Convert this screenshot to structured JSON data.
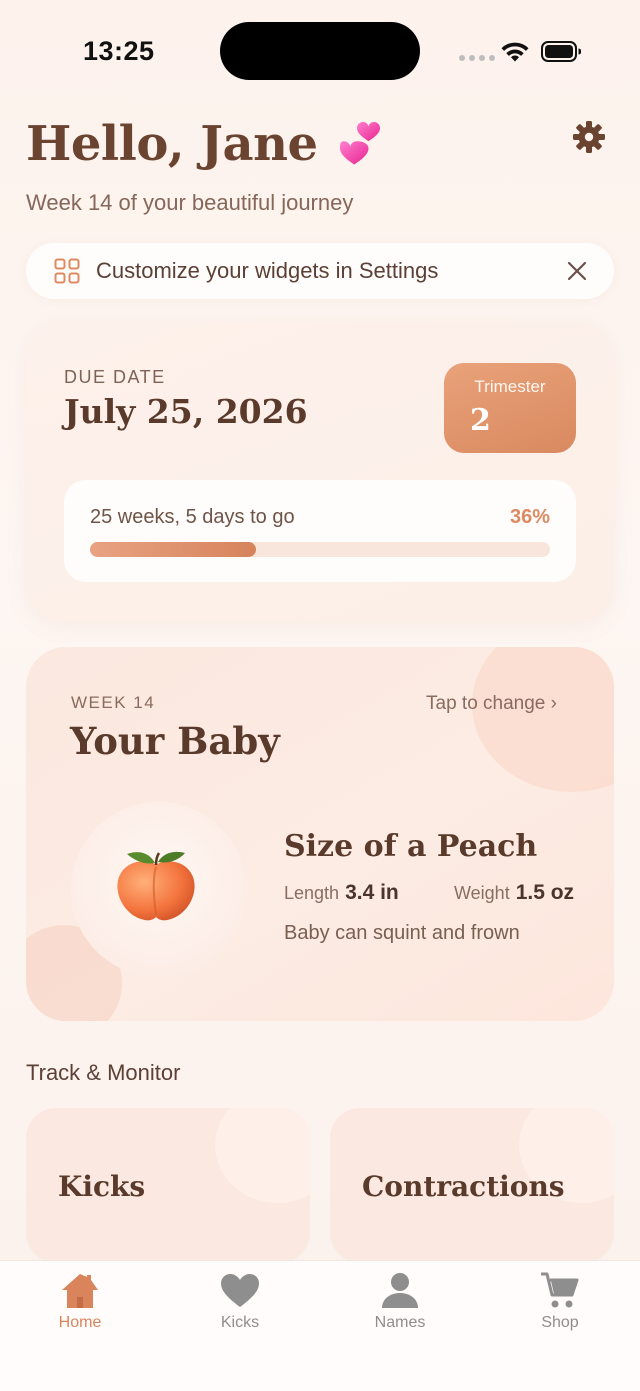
{
  "status_bar": {
    "time": "13:25"
  },
  "header": {
    "greeting": "Hello, Jane",
    "subtitle": "Week 14 of your beautiful journey"
  },
  "banner": {
    "text": "Customize your widgets in Settings"
  },
  "due_card": {
    "label": "DUE DATE",
    "date": "July 25, 2026",
    "trimester_label": "Trimester",
    "trimester_value": "2",
    "countdown": "25 weeks, 5 days to go",
    "progress_text": "36%",
    "progress_value": 0.36
  },
  "baby_card": {
    "week_label": "WEEK 14",
    "tap_label": "Tap to change ›",
    "title": "Your Baby",
    "size_title": "Size of a Peach",
    "length_label": "Length",
    "length_value": "3.4 in",
    "weight_label": "Weight",
    "weight_value": "1.5 oz",
    "fact": "Baby can squint and frown"
  },
  "track_section": {
    "title": "Track & Monitor",
    "tiles": [
      {
        "label": "Kicks"
      },
      {
        "label": "Contractions"
      }
    ]
  },
  "tab_bar": {
    "tabs": [
      {
        "label": "Home",
        "icon": "home-icon",
        "active": true
      },
      {
        "label": "Kicks",
        "icon": "heart-icon",
        "active": false
      },
      {
        "label": "Names",
        "icon": "person-icon",
        "active": false
      },
      {
        "label": "Shop",
        "icon": "cart-icon",
        "active": false
      }
    ]
  },
  "colors": {
    "accent": "#d9845b",
    "title_brown": "#6b4431",
    "background": "#fdf4ef",
    "inactive_tab": "#8e8e8e"
  }
}
